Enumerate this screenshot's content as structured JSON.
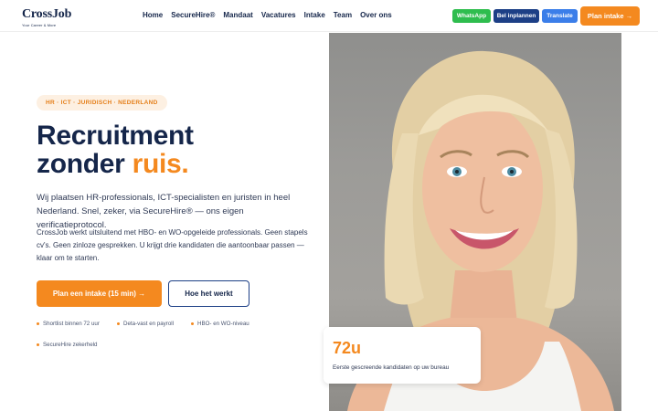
{
  "header": {
    "logo": {
      "name": "CrossJob",
      "tagline": "Your Career & More"
    },
    "nav": [
      "Home",
      "SecureHire®",
      "Mandaat",
      "Vacatures",
      "Intake",
      "Team",
      "Over ons"
    ],
    "buttons": {
      "whatsapp": "WhatsApp",
      "call": "Bel inplannen",
      "translate": "Translate",
      "plan": "Plan intake →"
    }
  },
  "hero": {
    "pill": "HR · ICT · JURIDISCH · NEDERLAND",
    "title_line1": "Recruitment",
    "title_line2_a": "zonder ",
    "title_line2_b": "ruis.",
    "paragraph1": "Wij plaatsen HR-professionals, ICT-specialisten en juristen in heel Nederland. Snel, zeker, via SecureHire® — ons eigen verificatieprotocol.",
    "paragraph2": "CrossJob werkt uitsluitend met HBO- en WO-opgeleide professionals. Geen stapels cv's. Geen zinloze gesprekken. U krijgt drie kandidaten die aantoonbaar passen — klaar om te starten.",
    "primary_button": "Plan een intake (15 min) →",
    "secondary_button": "Hoe het werkt",
    "features": [
      "Shortlist binnen 72 uur",
      "Deta-vast en payroll",
      "HBO- en WO-niveau",
      "SecureHire zekerheld"
    ]
  },
  "stat_card": {
    "value": "72u",
    "label": "Eerste gescreende kandidaten op uw bureau"
  },
  "colors": {
    "navy": "#15264a",
    "orange": "#f4891f",
    "whatsapp_green": "#2ebd4e",
    "call_blue": "#1c3f86",
    "translate_blue": "#3b7ee9"
  }
}
